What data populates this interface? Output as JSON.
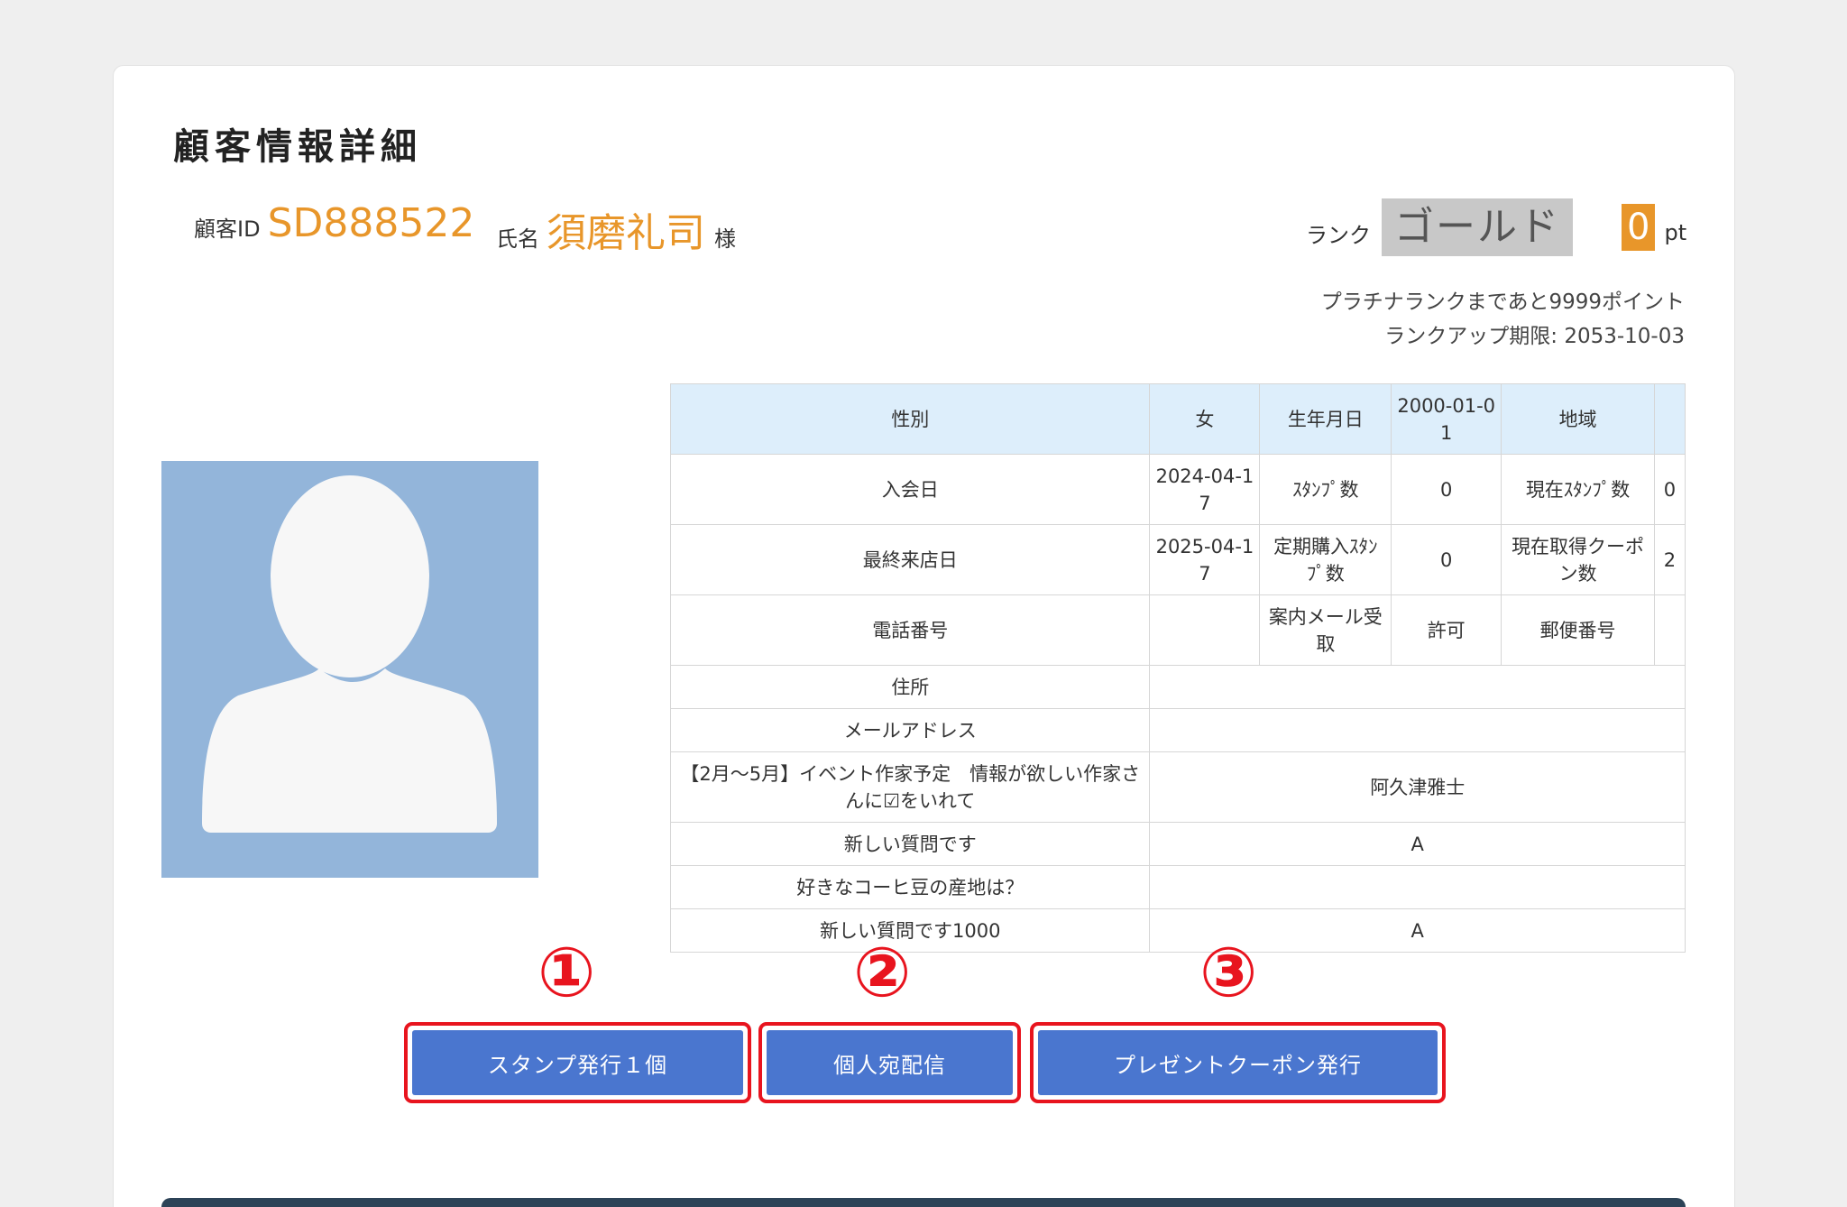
{
  "page": {
    "title": "顧客情報詳細"
  },
  "customer": {
    "id_label": "顧客ID",
    "id": "SD888522",
    "name_label": "氏名",
    "name": "須磨礼司",
    "name_suffix": "様",
    "rank_label": "ランク",
    "rank": "ゴールド",
    "points": "0",
    "points_unit": "pt",
    "rank_note_line1": "プラチナランクまであと9999ポイント",
    "rank_note_line2": "ランクアップ期限: 2053-10-03"
  },
  "table": {
    "gender_label": "性別",
    "gender": "女",
    "birthday_label": "生年月日",
    "birthday": "2000-01-01",
    "region_label": "地域",
    "region": "",
    "join_label": "入会日",
    "join": "2024-04-17",
    "stamp_label": "ｽﾀﾝﾌﾟ数",
    "stamp": "0",
    "cur_stamp_label": "現在ｽﾀﾝﾌﾟ数",
    "cur_stamp": "0",
    "last_visit_label": "最終来店日",
    "last_visit": "2025-04-17",
    "sub_stamp_label": "定期購入ｽﾀﾝﾌﾟ数",
    "sub_stamp": "0",
    "coupon_label": "現在取得クーポン数",
    "coupon": "2",
    "phone_label": "電話番号",
    "phone": "",
    "mail_ok_label": "案内メール受取",
    "mail_ok": "許可",
    "postal_label": "郵便番号",
    "postal": "",
    "address_label": "住所",
    "address": "",
    "email_label": "メールアドレス",
    "email": "",
    "q1_label": "【2月～5月】イベント作家予定　情報が欲しい作家さんに☑をいれて",
    "q1": "阿久津雅士",
    "q2_label": "新しい質問です",
    "q2": "A",
    "q3_label": "好きなコーヒ豆の産地は？",
    "q3": "",
    "q4_label": "新しい質問です1000",
    "q4": "A"
  },
  "markers": {
    "m1": "①",
    "m2": "②",
    "m3": "③"
  },
  "actions": {
    "stamp_issue": "スタンプ発行１個",
    "personal_message": "個人宛配信",
    "present_coupon": "プレゼントクーポン発行"
  },
  "colors": {
    "accent": "#e8962a",
    "button": "#4a76cf",
    "highlight": "#e8141e",
    "table_header": "#ddeefb",
    "rank_badge": "#c8c8c8"
  }
}
